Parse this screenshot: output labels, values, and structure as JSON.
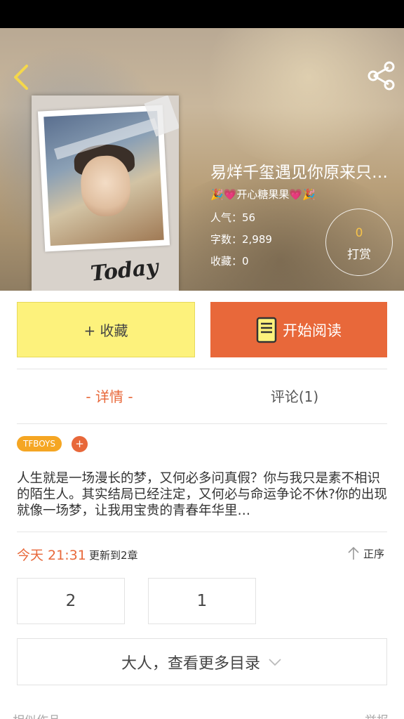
{
  "colors": {
    "accent_orange": "#e8683a",
    "collect_yellow": "#fdf27c",
    "reward_gold": "#f5c24a",
    "tag_orange": "#f5a623"
  },
  "header": {
    "back_icon": "chevron-left-icon",
    "share_icon": "share-icon"
  },
  "book": {
    "title": "易烊千玺遇见你原来只…",
    "author": "🎉💗开心糖果果💗🎉",
    "popularity": "人气：56",
    "word_count": "字数：2,989",
    "favorites": "收藏：0",
    "cover_signature": "Today"
  },
  "reward": {
    "count": "0",
    "label": "打赏"
  },
  "actions": {
    "collect_label": "+ 收藏",
    "read_label": "开始阅读",
    "read_icon": "book-icon"
  },
  "tabs": {
    "detail": "- 详情 -",
    "comments": "评论(1)"
  },
  "tags": {
    "items": [
      "TFBOYS"
    ],
    "add_label": "+"
  },
  "description": "人生就是一场漫长的梦，又何必多问真假？你与我只是素不相识的陌生人。其实结局已经注定，又何必与命运争论不休?你的出现就像一场梦，让我用宝贵的青春年华里…",
  "update": {
    "time": "今天 21:31",
    "text": "更新到2章",
    "order_label": "正序",
    "order_icon": "arrow-up-icon"
  },
  "chapters": [
    "2",
    "1"
  ],
  "toc": {
    "label": "大人，查看更多目录",
    "icon": "chevron-down-icon"
  },
  "footer": {
    "similar_label": "相似作品",
    "report_label": "举报"
  }
}
